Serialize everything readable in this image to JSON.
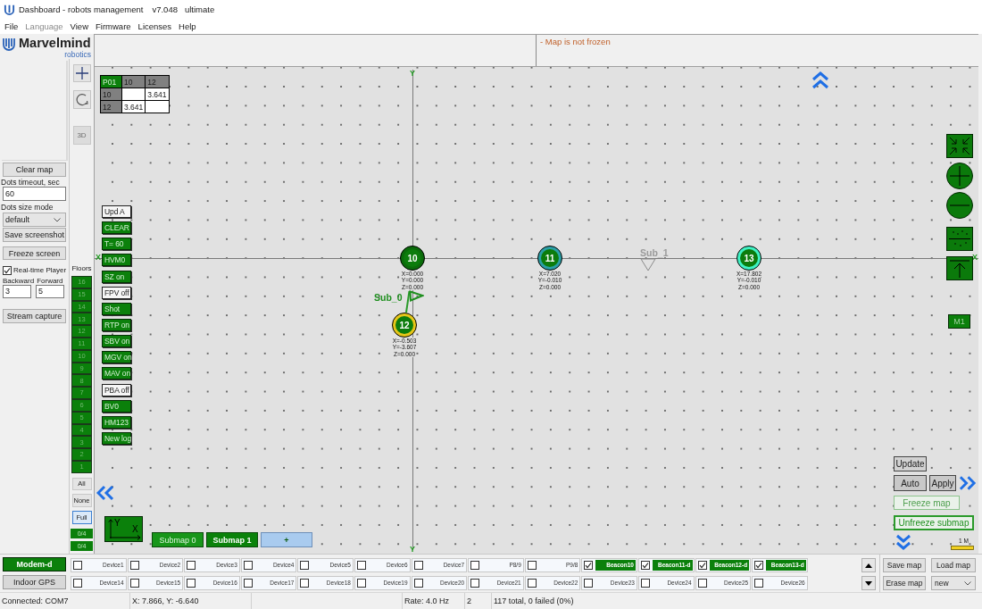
{
  "window": {
    "title": "Dashboard - robots management",
    "version": "v7.048",
    "edition": "ultimate"
  },
  "menu": [
    {
      "label": "File",
      "disabled": false
    },
    {
      "label": "Language",
      "disabled": true
    },
    {
      "label": "View",
      "disabled": false
    },
    {
      "label": "Firmware",
      "disabled": false
    },
    {
      "label": "Licenses",
      "disabled": false
    },
    {
      "label": "Help",
      "disabled": false
    }
  ],
  "logo": {
    "name": "Marvelmind",
    "tagline": "robotics"
  },
  "left_panel": {
    "clear_map": "Clear map",
    "dots_timeout": {
      "label": "Dots timeout, sec",
      "value": "60"
    },
    "dots_size_mode": {
      "label": "Dots size mode",
      "value": "default"
    },
    "save_screenshot": "Save screenshot",
    "freeze_screen": "Freeze screen",
    "realtime_player": {
      "label": "Real-time Player",
      "checked": true
    },
    "backward": {
      "label": "Backward",
      "value": "3"
    },
    "forward": {
      "label": "Forward",
      "value": "5"
    },
    "stream_capture": "Stream capture"
  },
  "view_tools": {
    "view_3d": {
      "label": "3D",
      "disabled": true
    }
  },
  "floors": {
    "label": "Floors",
    "items": [
      {
        "label": "16",
        "selected": true
      },
      {
        "label": "15",
        "selected": true
      },
      {
        "label": "14",
        "selected": true
      },
      {
        "label": "13",
        "selected": true
      },
      {
        "label": "12",
        "selected": true
      },
      {
        "label": "11",
        "selected": true
      },
      {
        "label": "10",
        "selected": true
      },
      {
        "label": "9",
        "selected": true
      },
      {
        "label": "8",
        "selected": true
      },
      {
        "label": "7",
        "selected": true
      },
      {
        "label": "6",
        "selected": true
      },
      {
        "label": "5",
        "selected": true
      },
      {
        "label": "4",
        "selected": true
      },
      {
        "label": "3",
        "selected": true
      },
      {
        "label": "2",
        "selected": true
      },
      {
        "label": "1",
        "selected": true
      }
    ],
    "modes": [
      {
        "label": "All",
        "selected": false
      },
      {
        "label": "None",
        "selected": false
      },
      {
        "label": "Full",
        "selected": true
      }
    ],
    "counters": [
      "0/4",
      "0/4"
    ]
  },
  "info_panel": {
    "messages": [
      "- Map is not frozen"
    ]
  },
  "map": {
    "axis_labels": {
      "x": [
        "X",
        "X"
      ],
      "y": [
        "Y",
        "Y"
      ]
    },
    "distance_table": {
      "header": [
        "P01",
        "10",
        "12"
      ],
      "rows": [
        {
          "label": "10",
          "cells": [
            null,
            "3.641"
          ]
        },
        {
          "label": "12",
          "cells": [
            "3.641",
            null
          ]
        }
      ]
    },
    "buttons": [
      {
        "label": "Upd A",
        "on": false
      },
      {
        "label": "CLEAR",
        "on": true
      },
      {
        "label": "T= 60",
        "on": true
      },
      {
        "label": "HVM0",
        "on": true
      },
      {
        "label": "SZ on",
        "on": true
      },
      {
        "label": "FPV off",
        "on": false
      },
      {
        "label": "Shot",
        "on": true
      },
      {
        "label": "RTP on",
        "on": true
      },
      {
        "label": "SBV on",
        "on": true
      },
      {
        "label": "MGV on",
        "on": true
      },
      {
        "label": "MAV on",
        "on": true
      },
      {
        "label": "PBA off",
        "on": false
      },
      {
        "label": "BV0",
        "on": true
      },
      {
        "label": "HM123",
        "on": true
      },
      {
        "label": "New log",
        "on": true
      }
    ],
    "beacons": [
      {
        "id": "10",
        "color": "#0b6b0b",
        "coordinates": [
          "X=0.000",
          "Y=0.000",
          "Z=0.000"
        ]
      },
      {
        "id": "11",
        "color": "#2a9fa6",
        "coordinates": [
          "X=7.020",
          "Y=-0.010",
          "Z=0.000"
        ]
      },
      {
        "id": "12",
        "color": "#e6c619",
        "coordinates": [
          "X=-0.503",
          "Y=-3.607",
          "Z=0.000"
        ]
      },
      {
        "id": "13",
        "color": "#3ff2c4",
        "coordinates": [
          "X=17.802",
          "Y=-0.010",
          "Z=0.000"
        ]
      }
    ],
    "submap_markers": [
      {
        "label": "Sub_0",
        "active": true
      },
      {
        "label": "Sub_1",
        "active": false
      }
    ],
    "axis_widget": {
      "y": "Y",
      "x": "X"
    },
    "submap_tabs": [
      {
        "label": "Submap 0",
        "selected": false
      },
      {
        "label": "Submap 1",
        "selected": true
      }
    ],
    "add_submap": "+",
    "marker_label": "M1",
    "update": "Update",
    "auto": "Auto",
    "apply": "Apply",
    "freeze_map": {
      "label": "Freeze map",
      "disabled": true
    },
    "unfreeze_submap": "Unfreeze submap",
    "scale": "1 M"
  },
  "modes": [
    {
      "label": "Modem-d",
      "selected": true
    },
    {
      "label": "Indoor GPS",
      "selected": false
    }
  ],
  "devices": [
    {
      "label": "Device1",
      "checked": false
    },
    {
      "label": "Device2",
      "checked": false
    },
    {
      "label": "Device3",
      "checked": false
    },
    {
      "label": "Device4",
      "checked": false
    },
    {
      "label": "Device5",
      "checked": false
    },
    {
      "label": "Device6",
      "checked": false
    },
    {
      "label": "Device7",
      "checked": false
    },
    {
      "label": "P8/9",
      "checked": false
    },
    {
      "label": "P9/8",
      "checked": false
    },
    {
      "label": "Beacon10",
      "checked": true
    },
    {
      "label": "Beacon11-d",
      "checked": true
    },
    {
      "label": "Beacon12-d",
      "checked": true
    },
    {
      "label": "Beacon13-d",
      "checked": true
    },
    {
      "label": "Device14",
      "checked": false
    },
    {
      "label": "Device15",
      "checked": false
    },
    {
      "label": "Device16",
      "checked": false
    },
    {
      "label": "Device17",
      "checked": false
    },
    {
      "label": "Device18",
      "checked": false
    },
    {
      "label": "Device19",
      "checked": false
    },
    {
      "label": "Device20",
      "checked": false
    },
    {
      "label": "Device21",
      "checked": false
    },
    {
      "label": "Device22",
      "checked": false
    },
    {
      "label": "Device23",
      "checked": false
    },
    {
      "label": "Device24",
      "checked": false
    },
    {
      "label": "Device25",
      "checked": false
    },
    {
      "label": "Device26",
      "checked": false
    }
  ],
  "map_actions": {
    "save": "Save map",
    "load": "Load map",
    "erase": "Erase map",
    "mode": "new"
  },
  "status_bar": {
    "connection": "Connected: COM7",
    "cursor": "X: 7.866, Y: -6.640",
    "rate": "Rate: 4.0 Hz",
    "count": "2",
    "packets": "117 total, 0 failed (0%)"
  }
}
